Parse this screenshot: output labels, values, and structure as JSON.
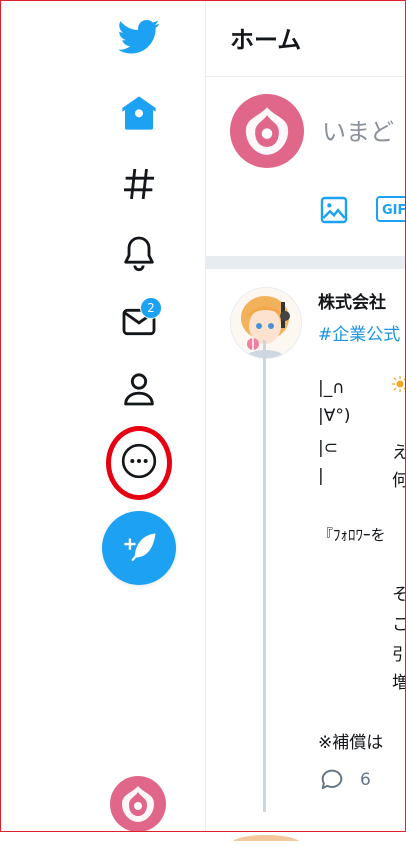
{
  "sidebar": {
    "notification_badge": "2",
    "items": [
      {
        "name": "twitter-logo",
        "icon": "bird-icon"
      },
      {
        "name": "home",
        "icon": "home-icon"
      },
      {
        "name": "explore",
        "icon": "hashtag-icon"
      },
      {
        "name": "notifications",
        "icon": "bell-icon"
      },
      {
        "name": "messages",
        "icon": "envelope-icon"
      },
      {
        "name": "profile",
        "icon": "person-icon"
      },
      {
        "name": "more",
        "icon": "more-circle-icon"
      },
      {
        "name": "tweet",
        "icon": "compose-tweet-icon"
      }
    ],
    "highlight_color": "#e60012"
  },
  "main": {
    "header_title": "ホーム",
    "compose": {
      "placeholder": "いまど",
      "gif_label": "GIF"
    },
    "tweet": {
      "author": "株式会社",
      "hashtag": "#企業公式",
      "lines": {
        "l1": "|_∩",
        "l2": "|∀°)",
        "l3": "|⊂",
        "l3b": "え",
        "l4": "|",
        "l4b": "何",
        "l5": "『ﾌｫﾛﾜｰを",
        "l6": "そ",
        "l7": "こ",
        "l8": "引",
        "l9": "増",
        "l10": "※補償は"
      },
      "reply_count": "6"
    }
  },
  "colors": {
    "accent": "#1da1f2",
    "avatar_pink": "#e0678a",
    "divider": "#e6ecf0"
  }
}
